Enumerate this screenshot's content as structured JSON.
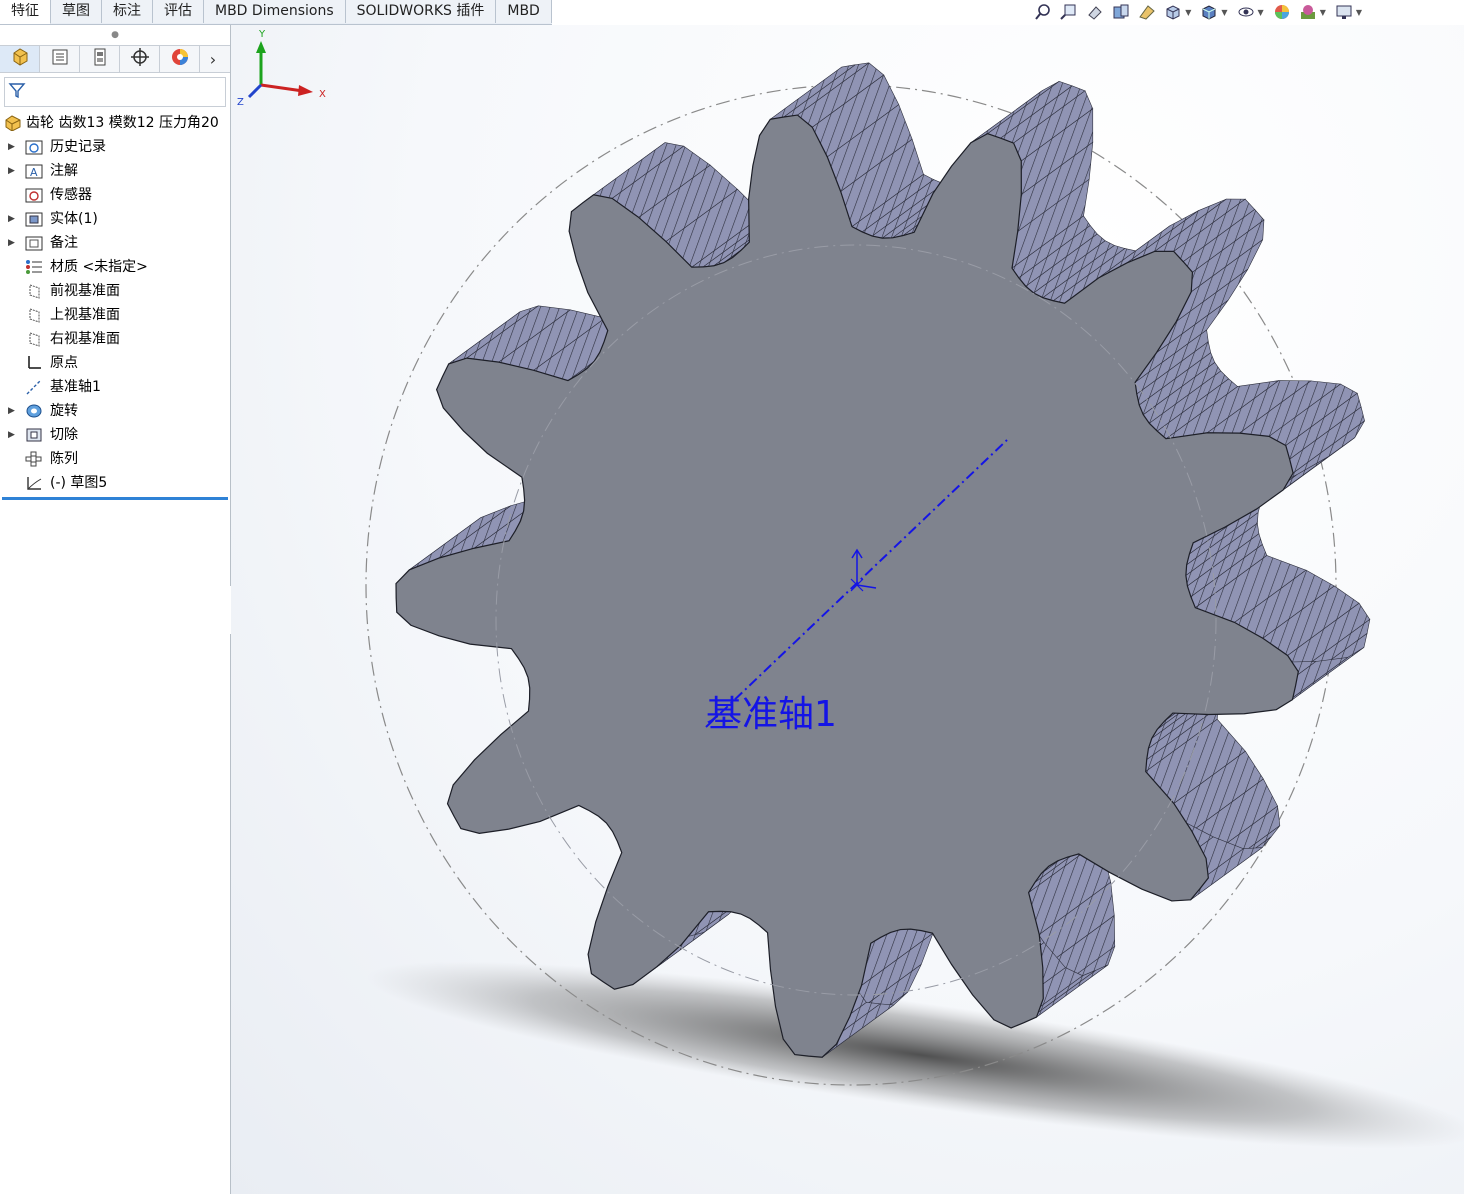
{
  "command_tabs": [
    "特征",
    "草图",
    "标注",
    "评估",
    "MBD Dimensions",
    "SOLIDWORKS 插件",
    "MBD"
  ],
  "active_tab": "特征",
  "heads_up_toolbar": [
    "zoom-to-fit-icon",
    "zoom-area-icon",
    "previous-view-icon",
    "section-view-icon",
    "dynamic-annotation-icon",
    "view-orientation-icon",
    "display-style-icon",
    "hide-show-items-icon",
    "edit-appearance-icon",
    "apply-scene-icon",
    "view-settings-icon"
  ],
  "panel_tabs": [
    "featuremanager-icon",
    "propertymanager-icon",
    "configurationmanager-icon",
    "dimxpert-icon",
    "display-manager-icon"
  ],
  "tree": {
    "root": "齿轮 齿数13 模数12 压力角20",
    "items": [
      {
        "label": "历史记录",
        "icon": "history-folder-icon",
        "expandable": true
      },
      {
        "label": "注解",
        "icon": "annotations-icon",
        "expandable": true
      },
      {
        "label": "传感器",
        "icon": "sensors-icon",
        "expandable": false
      },
      {
        "label": "实体(1)",
        "icon": "solid-bodies-icon",
        "expandable": true
      },
      {
        "label": "备注",
        "icon": "notes-icon",
        "expandable": true
      },
      {
        "label": "材质 <未指定>",
        "icon": "material-icon",
        "expandable": false
      },
      {
        "label": "前视基准面",
        "icon": "plane-icon",
        "expandable": false
      },
      {
        "label": "上视基准面",
        "icon": "plane-icon",
        "expandable": false
      },
      {
        "label": "右视基准面",
        "icon": "plane-icon",
        "expandable": false
      },
      {
        "label": "原点",
        "icon": "origin-icon",
        "expandable": false
      },
      {
        "label": "基准轴1",
        "icon": "axis-icon",
        "expandable": false
      },
      {
        "label": "旋转",
        "icon": "revolve-icon",
        "expandable": true
      },
      {
        "label": "切除",
        "icon": "cut-icon",
        "expandable": true
      },
      {
        "label": "陈列",
        "icon": "pattern-icon",
        "expandable": false
      },
      {
        "label": "(-) 草图5",
        "icon": "sketch-icon",
        "expandable": false
      }
    ]
  },
  "viewport": {
    "axis_annotation": "基准轴1",
    "gear_teeth": 13,
    "triad_labels": {
      "x": "X",
      "y": "Y",
      "z": "Z"
    }
  },
  "colors": {
    "gear_face": "#7f838e",
    "gear_side": "#8f93b0",
    "axis_blue": "#1414e6",
    "rollback_bar": "#2f82d6"
  }
}
